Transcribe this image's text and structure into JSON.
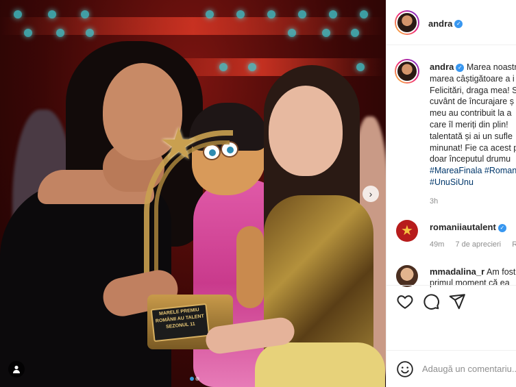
{
  "post": {
    "author": "andra",
    "trophy_plate": "MARELE PREMIU ROMÂNII AU TALENT SEZONUL 11"
  },
  "caption": {
    "author": "andra",
    "text_lines": [
      "Marea noastr",
      "marea câștigătoare a i",
      "Felicitări, draga mea! S",
      "cuvânt de încurajare ș",
      "meu au contribuit la a",
      "care îl meriți din plin!",
      "talentată și ai un sufle",
      "minunat! Fie ca acest p",
      "doar începutul drumu"
    ],
    "hashtags_line1": [
      "#MareaFinala",
      "#Roman"
    ],
    "hashtags_line2": [
      "#UnuSiUnu"
    ],
    "time": "3h"
  },
  "comments": [
    {
      "author": "romaniiautalent",
      "verified": true,
      "time": "49m",
      "likes": "7 de aprecieri",
      "reply": "Ră"
    },
    {
      "author": "mmadalina_r",
      "line1": "Am fost",
      "line2": "primul moment că ea"
    }
  ],
  "add_comment": {
    "placeholder": "Adaugă un comentariu..."
  },
  "icons": {
    "like": "heart-icon",
    "comment": "comment-bubble-icon",
    "share": "paper-plane-icon",
    "emoji": "smiley-icon",
    "verified": "verified-badge-icon",
    "next": "chevron-right-icon",
    "tag": "person-tag-icon"
  },
  "colors": {
    "verified": "#3897f0",
    "hashtag": "#00376b",
    "muted": "#8e8e8e",
    "like_red": "#ed4956"
  }
}
